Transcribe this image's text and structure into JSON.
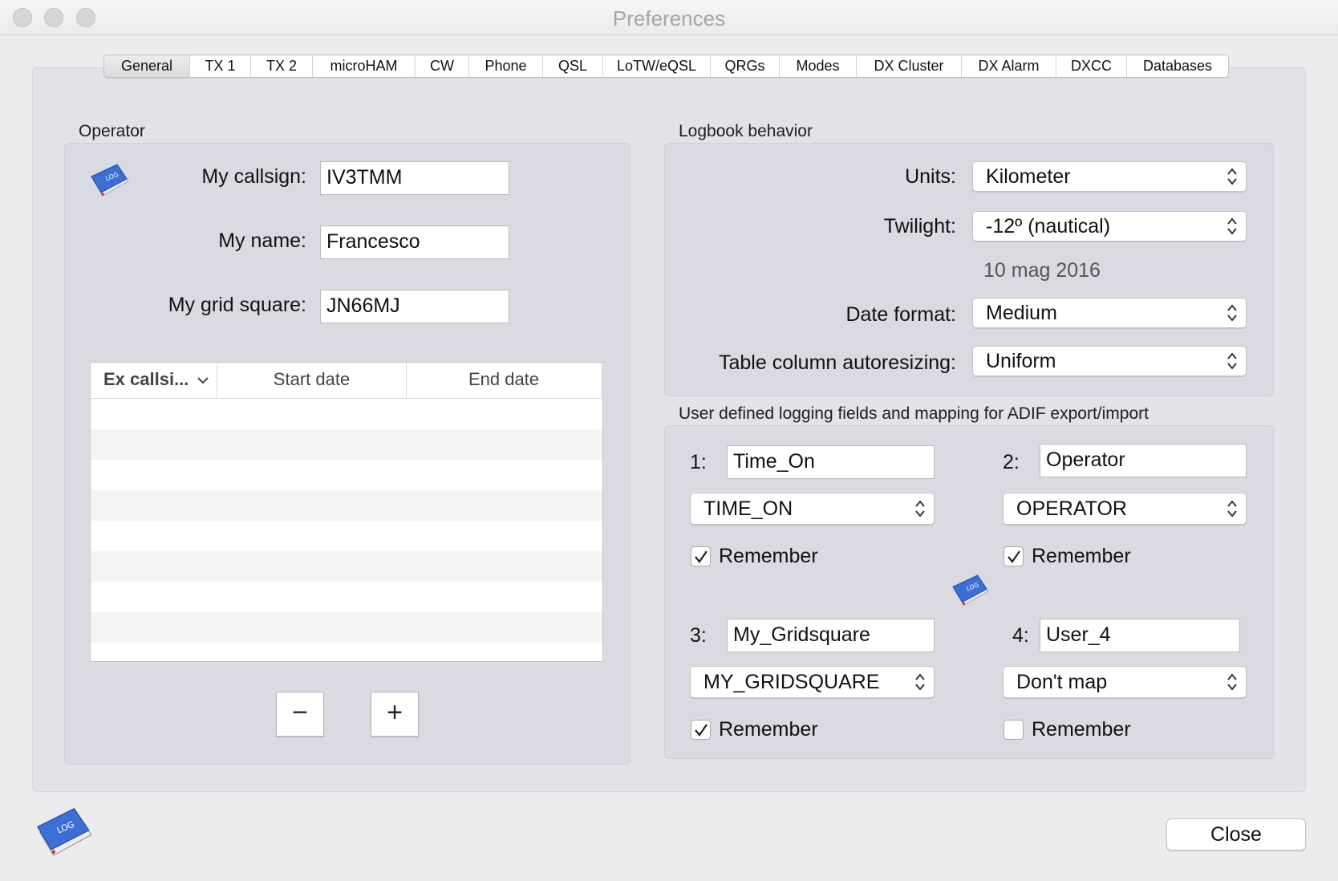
{
  "window": {
    "title": "Preferences"
  },
  "tabs": [
    {
      "label": "General",
      "active": true
    },
    {
      "label": "TX 1"
    },
    {
      "label": "TX 2"
    },
    {
      "label": "microHAM"
    },
    {
      "label": "CW"
    },
    {
      "label": "Phone"
    },
    {
      "label": "QSL"
    },
    {
      "label": "LoTW/eQSL"
    },
    {
      "label": "QRGs"
    },
    {
      "label": "Modes"
    },
    {
      "label": "DX Cluster"
    },
    {
      "label": "DX Alarm"
    },
    {
      "label": "DXCC"
    },
    {
      "label": "Databases"
    }
  ],
  "operator": {
    "group_label": "Operator",
    "callsign_label": "My callsign:",
    "callsign_value": "IV3TMM",
    "name_label": "My name:",
    "name_value": "Francesco",
    "grid_label": "My grid square:",
    "grid_value": "JN66MJ",
    "table": {
      "columns": [
        "Ex callsi...",
        "Start date",
        "End date"
      ],
      "rows": []
    },
    "remove_label": "−",
    "add_label": "+"
  },
  "logbook": {
    "group_label": "Logbook behavior",
    "units_label": "Units:",
    "units_value": "Kilometer",
    "twilight_label": "Twilight:",
    "twilight_value": "-12º (nautical)",
    "date_example": "10 mag 2016",
    "date_format_label": "Date format:",
    "date_format_value": "Medium",
    "autoresize_label": "Table column autoresizing:",
    "autoresize_value": "Uniform"
  },
  "user_fields": {
    "group_label": "User defined logging fields and mapping for ADIF export/import",
    "remember_label": "Remember",
    "fields": [
      {
        "num": "1:",
        "name": "Time_On",
        "mapping": "TIME_ON",
        "remember": true
      },
      {
        "num": "2:",
        "name": "Operator",
        "mapping": "OPERATOR",
        "remember": true
      },
      {
        "num": "3:",
        "name": "My_Gridsquare",
        "mapping": "MY_GRIDSQUARE",
        "remember": true
      },
      {
        "num": "4:",
        "name": "User_4",
        "mapping": "Don't map",
        "remember": false
      }
    ]
  },
  "footer": {
    "close_label": "Close"
  },
  "icons": {
    "logbook": "logbook-icon",
    "logbook_text": "LOG"
  },
  "colors": {
    "book_blue": "#3b6fd6",
    "window_bg": "#ececef"
  }
}
